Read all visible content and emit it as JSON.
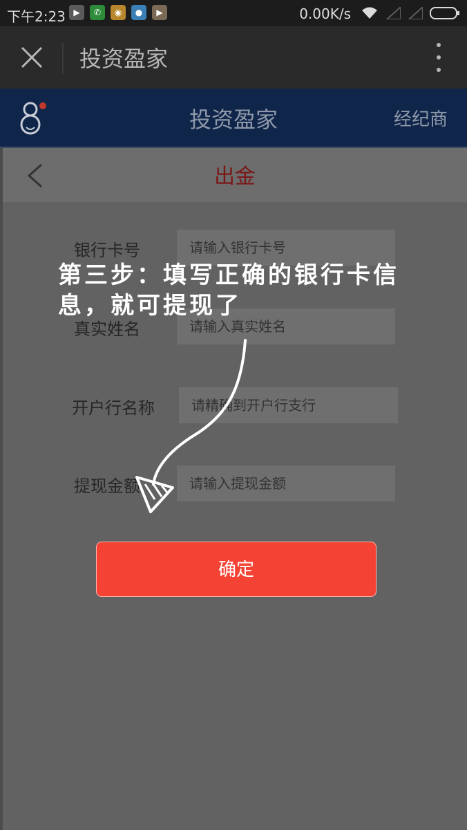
{
  "status_bar": {
    "time": "下午2:23",
    "network_speed": "0.00K/s",
    "app_icons": [
      "play-store-icon",
      "phone-icon",
      "chrome-icon",
      "qq-browser-icon",
      "video-icon"
    ]
  },
  "browser_toolbar": {
    "title": "投资盈家"
  },
  "app_header": {
    "title": "投资盈家",
    "broker_label": "经纪商"
  },
  "page": {
    "title": "出金"
  },
  "form": {
    "bank_card": {
      "label": "银行卡号",
      "placeholder": "请输入银行卡号"
    },
    "real_name": {
      "label": "真实姓名",
      "placeholder": "请输入真实姓名"
    },
    "bank_branch": {
      "label": "开户行名称",
      "placeholder": "请精确到开户行支行"
    },
    "amount": {
      "label": "提现金额",
      "placeholder": "请输入提现金额"
    },
    "confirm_label": "确定"
  },
  "tutorial_overlay": {
    "text": "第三步：填写正确的银行卡信息，就可提现了"
  },
  "colors": {
    "confirm_button": "#f44334",
    "page_title": "#7a1818",
    "app_header_bg": "#0f254a"
  }
}
